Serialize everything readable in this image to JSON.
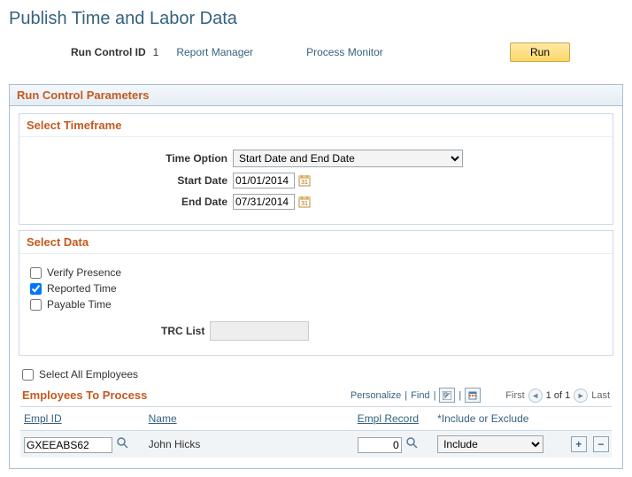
{
  "page": {
    "title": "Publish Time and Labor Data",
    "run_control_label": "Run Control ID",
    "run_control_value": "1",
    "links": {
      "report_manager": "Report Manager",
      "process_monitor": "Process Monitor"
    },
    "run_button": "Run"
  },
  "parameters": {
    "title": "Run Control Parameters",
    "timeframe": {
      "title": "Select Timeframe",
      "time_option_label": "Time Option",
      "time_option_value": "Start Date and End Date",
      "start_date_label": "Start Date",
      "start_date_value": "01/01/2014",
      "end_date_label": "End Date",
      "end_date_value": "07/31/2014"
    },
    "data": {
      "title": "Select Data",
      "verify_presence_label": "Verify Presence",
      "verify_presence_checked": false,
      "reported_time_label": "Reported Time",
      "reported_time_checked": true,
      "payable_time_label": "Payable Time",
      "payable_time_checked": false,
      "trc_list_label": "TRC List"
    },
    "select_all_label": "Select All Employees",
    "select_all_checked": false,
    "grid": {
      "title": "Employees To Process",
      "tools": {
        "personalize": "Personalize",
        "find": "Find"
      },
      "nav": {
        "first": "First",
        "counter": "1 of 1",
        "last": "Last"
      },
      "columns": {
        "emplid": "Empl ID",
        "name": "Name",
        "empl_record": "Empl Record",
        "include_exclude": "*Include or Exclude"
      },
      "rows": [
        {
          "emplid": "GXEEABS62",
          "name": "John Hicks",
          "empl_record": "0",
          "include_exclude": "Include"
        }
      ]
    }
  }
}
